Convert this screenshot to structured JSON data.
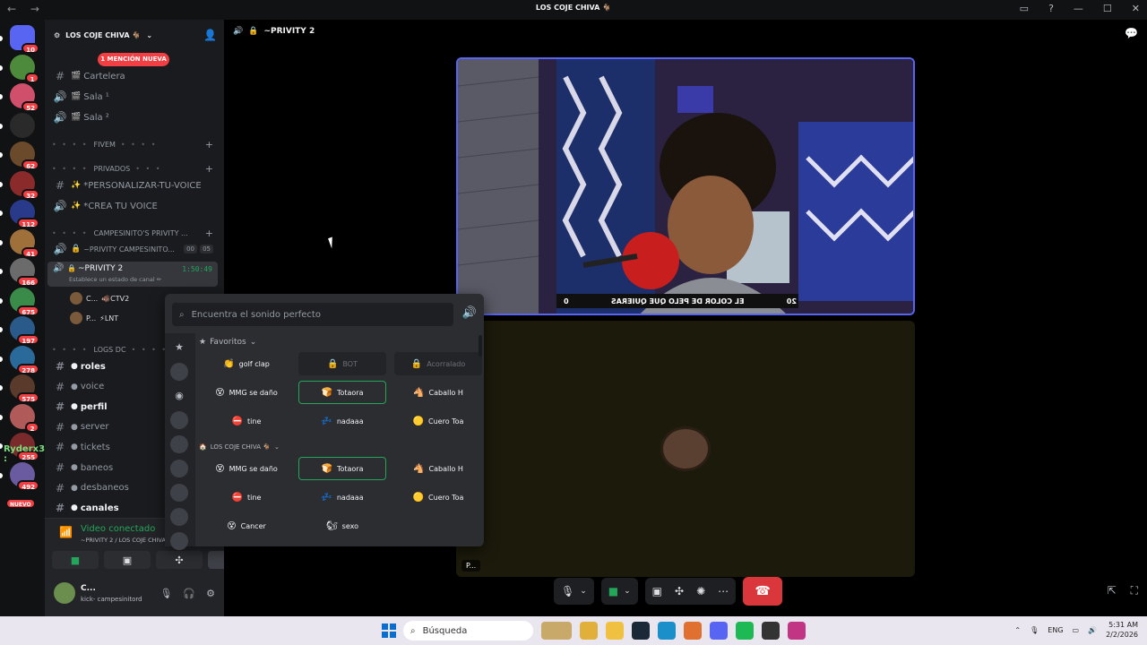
{
  "titlebar": {
    "title": "LOS COJE CHIVA 🐐",
    "nav": "← →",
    "icons": [
      "screen-icon",
      "help-icon",
      "minimize-icon",
      "maximize-icon",
      "close-icon"
    ],
    "glyphs": [
      "▭",
      "?",
      "—",
      "☐",
      "✕"
    ]
  },
  "rail": {
    "servers": [
      {
        "badge": "10"
      },
      {
        "badge": "1"
      },
      {
        "badge": "52"
      },
      {
        "badge": ""
      },
      {
        "badge": "62"
      },
      {
        "badge": "32"
      },
      {
        "badge": "112"
      },
      {
        "badge": "41"
      },
      {
        "badge": "166"
      },
      {
        "badge": "675"
      },
      {
        "badge": "197"
      },
      {
        "badge": "278"
      },
      {
        "badge": "575"
      },
      {
        "badge": "2"
      },
      {
        "badge": "255"
      },
      {
        "badge": "492"
      }
    ],
    "nuevo": "NUEVO",
    "floating_name": "Ryderx3 :"
  },
  "sidebar": {
    "guild_name": "LOS COJE CHIVA 🐐",
    "mention": "1 MENCIÓN NUEVA",
    "channels_top": [
      {
        "sym": "#",
        "emo": "🎬",
        "label": "Cartelera"
      },
      {
        "sym": "🔊",
        "emo": "🎬",
        "label": "Sala ¹"
      },
      {
        "sym": "🔊",
        "emo": "🎬",
        "label": "Sala ²"
      }
    ],
    "cat_fivem": "FIVEM",
    "cat_privados": "PRIVADOS",
    "priv_channels": [
      {
        "sym": "#",
        "emo": "✨",
        "label": "*PERSONALIZAR-TU-VOICE"
      },
      {
        "sym": "🔊",
        "emo": "✨",
        "label": "*CREA TU VOICE"
      }
    ],
    "cat_campesinito": "CAMPESINITO'S PRIVITY ...",
    "camp_channel": {
      "label": "~PRIVITY CAMPESINITO...",
      "count1": "00",
      "count2": "05"
    },
    "active_channel": {
      "label": "~PRIVITY 2",
      "timer": "1:50:49",
      "status": "Establece un estado de canal ✏"
    },
    "voice_users": [
      {
        "name": "C...",
        "tag": "🐗CTV2"
      },
      {
        "name": "P...",
        "tag": "⚡LNT"
      }
    ],
    "cat_logs": "LOGS DC",
    "log_channels": [
      {
        "label": "roles",
        "bright": true
      },
      {
        "label": "voice",
        "bright": false
      },
      {
        "label": "perfil",
        "bright": true
      },
      {
        "label": "server",
        "bright": false
      },
      {
        "label": "tickets",
        "bright": false
      },
      {
        "label": "baneos",
        "bright": false
      },
      {
        "label": "desbaneos",
        "bright": false
      },
      {
        "label": "canales",
        "bright": true
      }
    ],
    "connection": {
      "title": "Video conectado",
      "sub": "~PRIVITY 2 / LOS COJE CHIVA 🐐"
    },
    "user": {
      "name": "C...",
      "sub": "kick- campesinitord"
    }
  },
  "main": {
    "channel_title": "~PRIVITY 2",
    "tile2_label": "P...",
    "controls": {
      "hang_glyph": "☎"
    }
  },
  "soundboard": {
    "placeholder": "Encuentra el sonido perfecto",
    "favorites_label": "Favoritos",
    "server_label": "LOS COJE CHIVA 🐐",
    "favorites": [
      {
        "e": "👏",
        "label": "golf clap",
        "locked": false,
        "sel": false
      },
      {
        "e": "🔒",
        "label": "BOT",
        "locked": true,
        "sel": false
      },
      {
        "e": "🔒",
        "label": "Acorralado",
        "locked": true,
        "sel": false
      },
      {
        "e": "😵",
        "label": "MMG se daño",
        "locked": false,
        "sel": false
      },
      {
        "e": "🍞",
        "label": "Totaora",
        "locked": false,
        "sel": true
      },
      {
        "e": "🐴",
        "label": "Caballo H",
        "locked": false,
        "sel": false
      },
      {
        "e": "⛔",
        "label": "tine",
        "locked": false,
        "sel": false
      },
      {
        "e": "💤",
        "label": "nadaaa",
        "locked": false,
        "sel": false
      },
      {
        "e": "🟡",
        "label": "Cuero Toa",
        "locked": false,
        "sel": false
      }
    ],
    "server_sounds": [
      {
        "e": "😵",
        "label": "MMG se daño",
        "sel": false
      },
      {
        "e": "🍞",
        "label": "Totaora",
        "sel": true
      },
      {
        "e": "🐴",
        "label": "Caballo H",
        "sel": false
      },
      {
        "e": "⛔",
        "label": "tine",
        "sel": false
      },
      {
        "e": "💤",
        "label": "nadaaa",
        "sel": false
      },
      {
        "e": "🟡",
        "label": "Cuero Toa",
        "sel": false
      },
      {
        "e": "😵",
        "label": "Cancer",
        "sel": false
      },
      {
        "e": "🐿",
        "label": "sexo",
        "sel": false
      }
    ]
  },
  "stream_overlay": {
    "left": "20",
    "text": "EL COLOR DE PELO QUE QUIERAS",
    "right": "0"
  },
  "taskbar": {
    "search": "Búsqueda",
    "lang": "ENG",
    "time": "5:31 AM",
    "date": "2/2/2026"
  }
}
